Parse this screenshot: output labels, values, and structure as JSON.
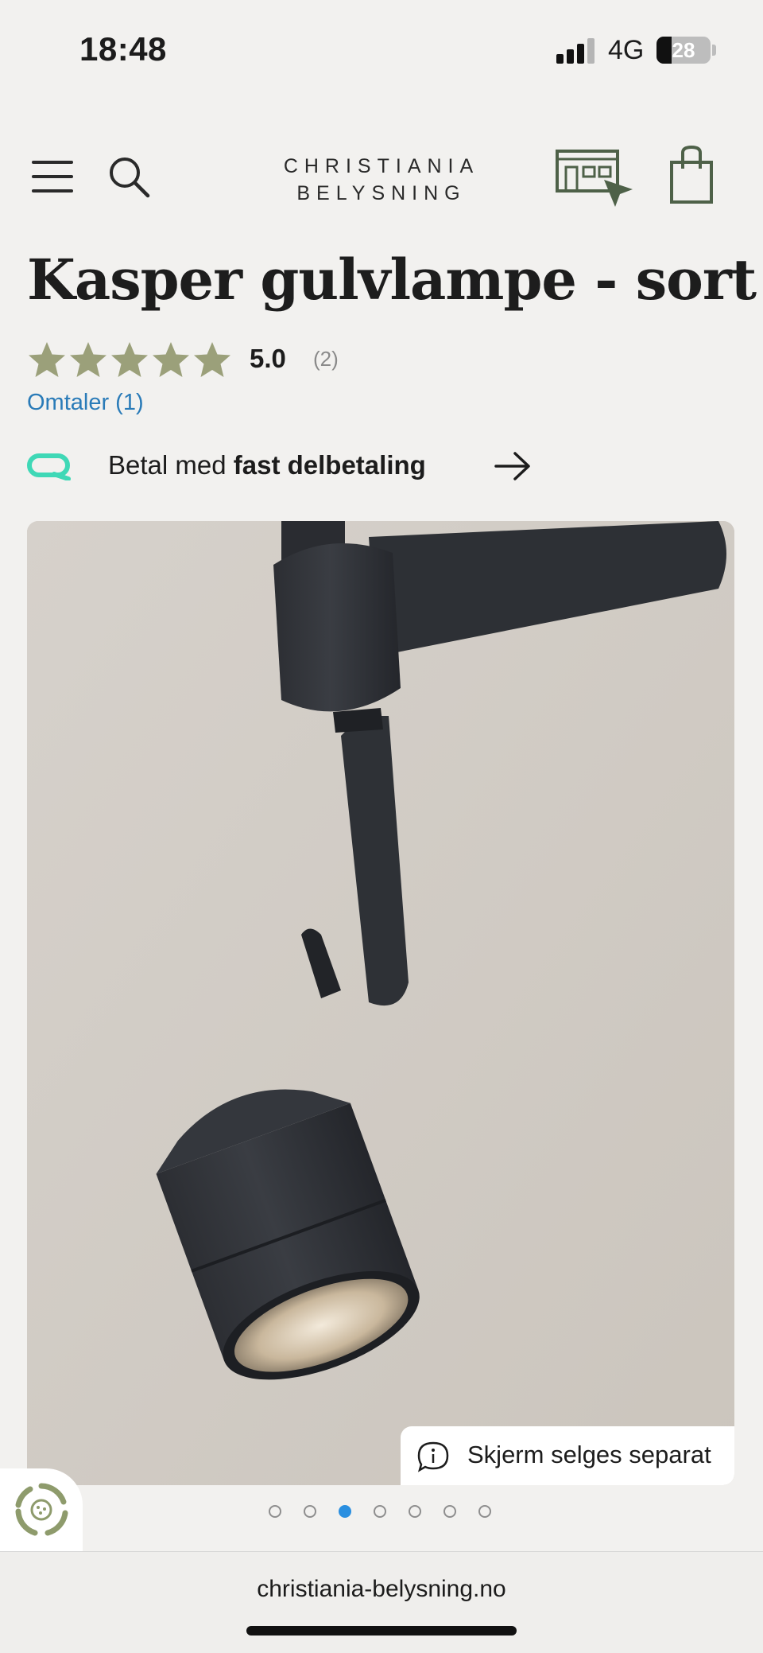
{
  "status_bar": {
    "time": "18:48",
    "network": "4G",
    "battery": "28"
  },
  "header": {
    "logo_line1": "CHRISTIANIA",
    "logo_line2": "BELYSNING",
    "icons": [
      "menu-icon",
      "search-icon",
      "store-icon",
      "shopping-bag-icon"
    ],
    "brand_color": "#4e6148"
  },
  "product": {
    "title": "Kasper gulvlampe - sort",
    "rating": {
      "value": "5.0",
      "count": "(2)",
      "stars": 5,
      "star_color": "#9ba07a"
    },
    "reviews_link": "Omtaler (1)",
    "payment": {
      "prefix": "Betal med",
      "highlight": "fast delbetaling",
      "logo_color": "#3fd8b6"
    }
  },
  "gallery": {
    "info_chip": "Skjerm selges separat",
    "dots_total": 7,
    "dots_active_index": 2,
    "active_color": "#2a8fe0"
  },
  "browser": {
    "url": "christiania-belysning.no"
  }
}
